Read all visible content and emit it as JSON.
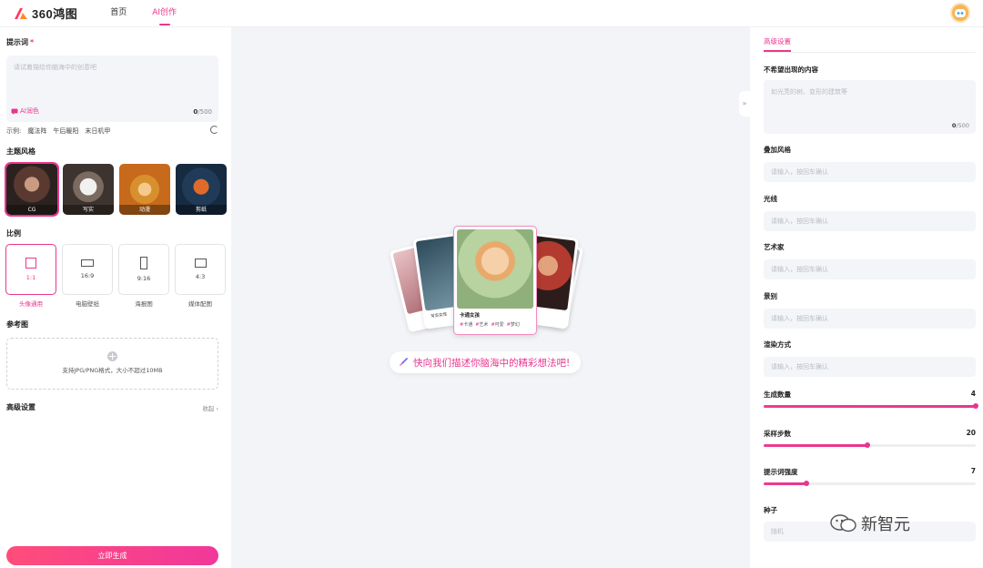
{
  "app": {
    "logo_text": "360鸿图"
  },
  "nav": {
    "items": [
      {
        "label": "首页"
      },
      {
        "label": "AI创作"
      }
    ]
  },
  "left": {
    "prompt": {
      "title": "提示词",
      "required_mark": "*",
      "placeholder": "请试着描绘你脑海中的创意吧",
      "ai_polish": "AI润色",
      "count": "0",
      "max": "/500"
    },
    "examples": {
      "label": "示例:",
      "items": [
        "魔法阵",
        "午后暖阳",
        "末日机甲"
      ]
    },
    "style": {
      "title": "主题风格",
      "items": [
        {
          "label": "CG",
          "active": true
        },
        {
          "label": "写实",
          "active": false
        },
        {
          "label": "动漫",
          "active": false
        },
        {
          "label": "剪纸",
          "active": false
        }
      ]
    },
    "ratio": {
      "title": "比例",
      "items": [
        {
          "value": "1:1",
          "name": "头像通用",
          "active": true
        },
        {
          "value": "16:9",
          "name": "电脑壁纸",
          "active": false
        },
        {
          "value": "9:16",
          "name": "海报图",
          "active": false
        },
        {
          "value": "4:3",
          "name": "媒体配图",
          "active": false
        }
      ]
    },
    "reference": {
      "title": "参考图",
      "hint": "支持JPG/PNG格式，大小不超过10MB"
    },
    "advanced": {
      "title": "高级设置",
      "collapse": "收起 ›"
    },
    "generate": "立即生成"
  },
  "center": {
    "collapse_tab": "»",
    "card": {
      "title": "卡通女孩",
      "tags": [
        "卡通",
        "艺术",
        "可爱",
        "梦幻"
      ]
    },
    "side_card": {
      "title": "写实女性"
    },
    "hint": "快向我们描述你脑海中的精彩想法吧!"
  },
  "right": {
    "tab": "高级设置",
    "negative": {
      "label": "不希望出现的内容",
      "placeholder": "如光秃的树、变形的建筑等",
      "count": "0",
      "max": "/500"
    },
    "fields": [
      {
        "label": "叠加风格",
        "placeholder": "请输入，按回车确认"
      },
      {
        "label": "光线",
        "placeholder": "请输入，按回车确认"
      },
      {
        "label": "艺术家",
        "placeholder": "请输入，按回车确认"
      },
      {
        "label": "景别",
        "placeholder": "请输入，按回车确认"
      },
      {
        "label": "渲染方式",
        "placeholder": "请输入，按回车确认"
      }
    ],
    "sliders": [
      {
        "label": "生成数量",
        "value": "4",
        "fraction": 1.0
      },
      {
        "label": "采样步数",
        "value": "20",
        "fraction": 0.49
      },
      {
        "label": "提示词强度",
        "value": "7",
        "fraction": 0.2
      }
    ],
    "seed": {
      "label": "种子",
      "placeholder": "随机"
    }
  },
  "watermark": {
    "text": "新智元"
  },
  "colors": {
    "accent": "#e8368f",
    "panel_bg": "#f3f4f7",
    "input_bg": "#f4f5f8"
  }
}
